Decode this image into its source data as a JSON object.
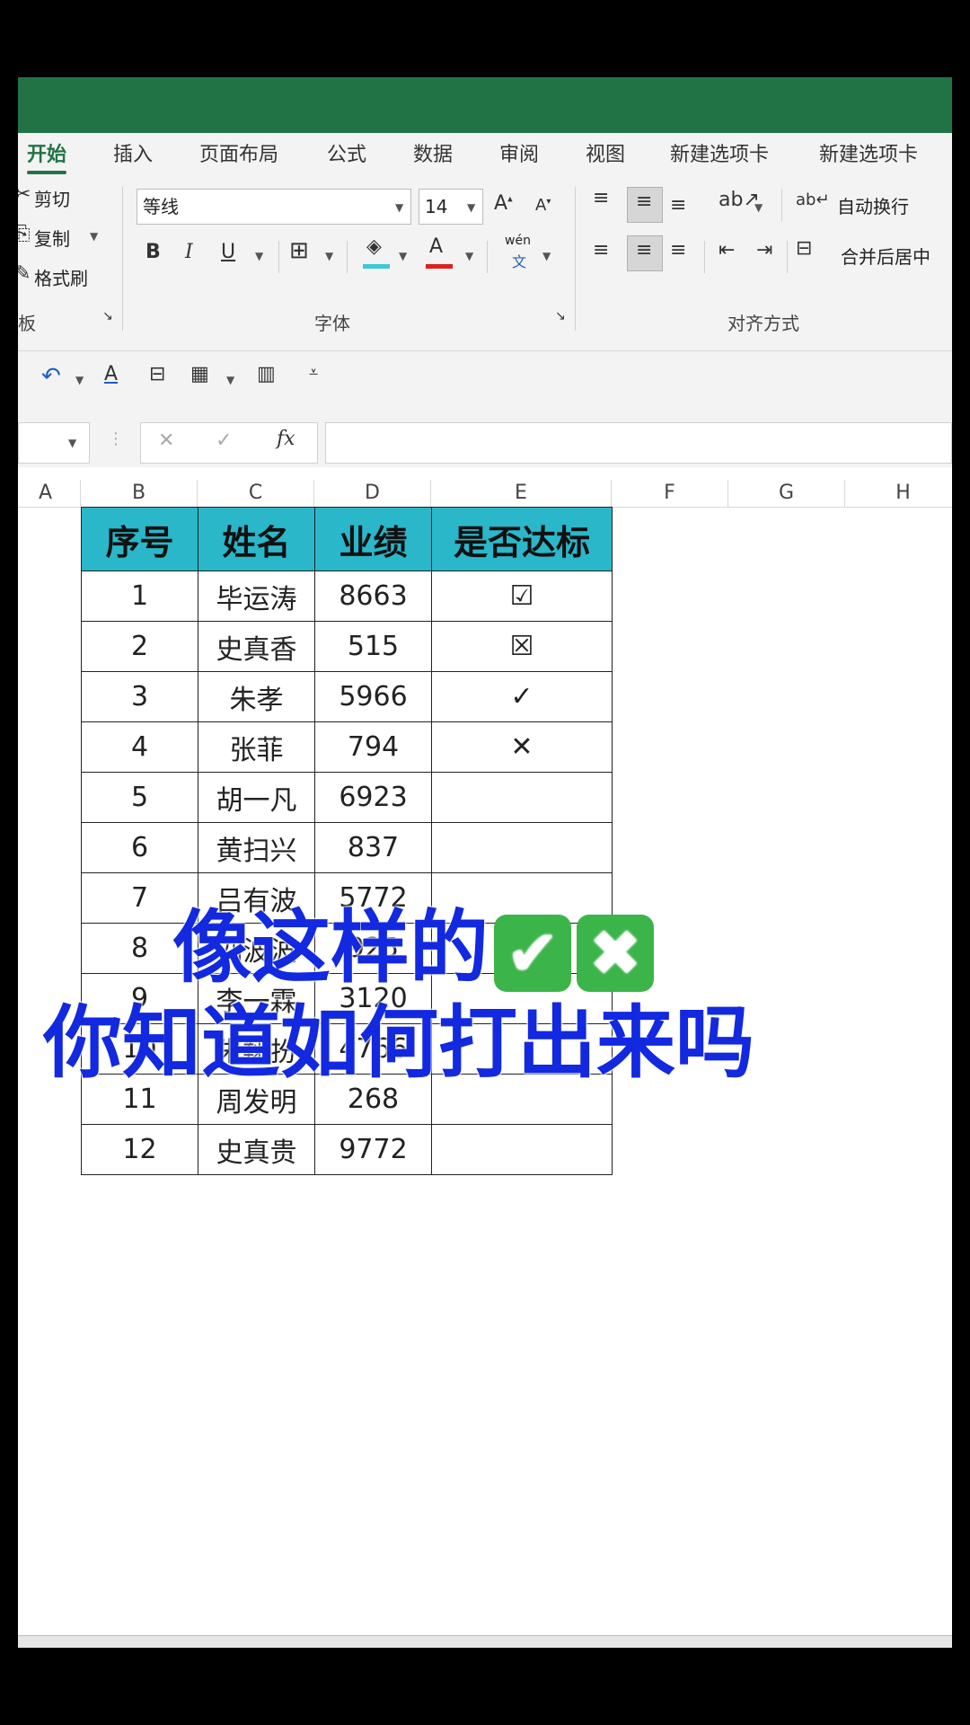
{
  "ribbon": {
    "tabs": [
      "开始",
      "插入",
      "页面布局",
      "公式",
      "数据",
      "审阅",
      "视图",
      "新建选项卡",
      "新建选项卡"
    ],
    "clipboard": {
      "cut": "剪切",
      "copy": "复制",
      "format_painter": "格式刷",
      "group_label": "板"
    },
    "font": {
      "name": "等线",
      "size": "14",
      "group_label": "字体",
      "bold": "B",
      "italic": "I",
      "underline": "U",
      "phonetic_top": "wén",
      "phonetic_bottom": "文"
    },
    "alignment": {
      "wrap_text": "自动换行",
      "merge_center": "合并后居中",
      "group_label": "对齐方式"
    }
  },
  "formula_bar": {
    "fx": "fx",
    "cancel": "✕",
    "enter": "✓"
  },
  "columns": [
    "A",
    "B",
    "C",
    "D",
    "E",
    "F",
    "G",
    "H"
  ],
  "table": {
    "headers": [
      "序号",
      "姓名",
      "业绩",
      "是否达标"
    ],
    "rows": [
      [
        "1",
        "毕运涛",
        "8663",
        "☑"
      ],
      [
        "2",
        "史真香",
        "515",
        "☒"
      ],
      [
        "3",
        "朱孝",
        "5966",
        "✓"
      ],
      [
        "4",
        "张菲",
        "794",
        "✕"
      ],
      [
        "5",
        "胡一凡",
        "6923",
        ""
      ],
      [
        "6",
        "黄扫兴",
        "837",
        ""
      ],
      [
        "7",
        "吕有波",
        "5772",
        ""
      ],
      [
        "8",
        "刘波波",
        "925",
        ""
      ],
      [
        "9",
        "李一霖",
        "3120",
        ""
      ],
      [
        "10",
        "朱翔扮",
        "4766",
        ""
      ],
      [
        "11",
        "周发明",
        "268",
        ""
      ],
      [
        "12",
        "史真贵",
        "9772",
        ""
      ]
    ]
  },
  "overlay": {
    "line1": "像这样的",
    "check_emoji": "✔",
    "cross_emoji": "✖",
    "line2": "你知道如何打出来吗"
  },
  "colors": {
    "excel_green": "#217346",
    "header_fill": "#2ab7c9",
    "caption_blue": "#1229e0"
  }
}
